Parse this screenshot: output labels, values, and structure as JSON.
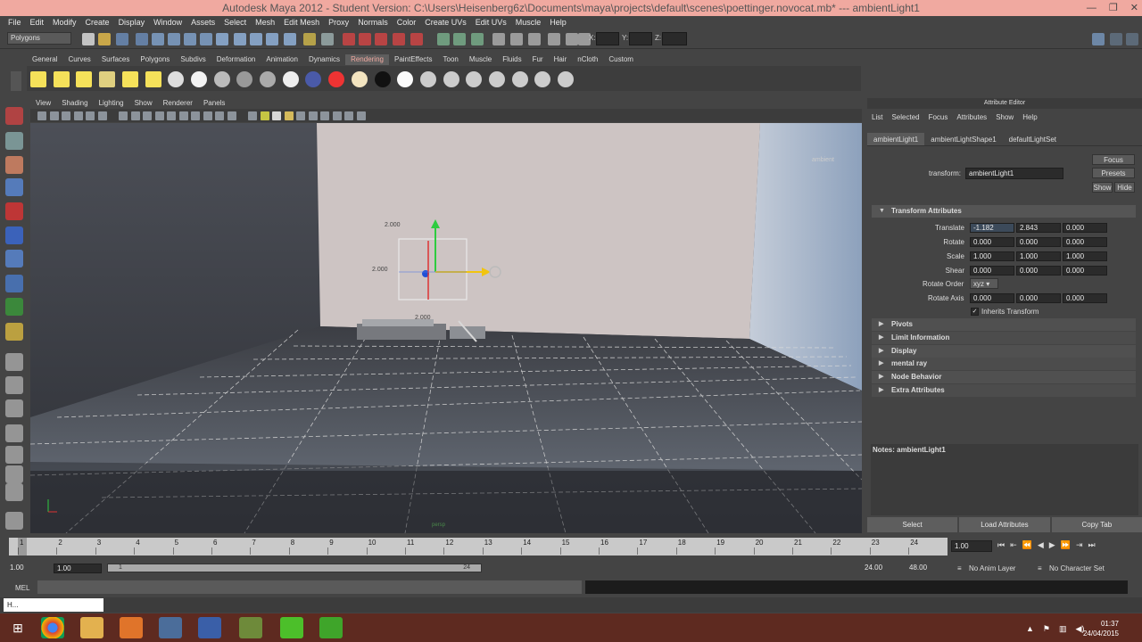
{
  "window": {
    "title": "Autodesk Maya 2012 - Student Version: C:\\Users\\Heisenberg6z\\Documents\\maya\\projects\\default\\scenes\\poettinger.novocat.mb*  ---  ambientLight1"
  },
  "menubar": [
    "File",
    "Edit",
    "Modify",
    "Create",
    "Display",
    "Window",
    "Assets",
    "Select",
    "Mesh",
    "Edit Mesh",
    "Proxy",
    "Normals",
    "Color",
    "Create UVs",
    "Edit UVs",
    "Muscle",
    "Help"
  ],
  "status": {
    "mode": "Polygons",
    "x_label": "X:",
    "y_label": "Y:",
    "z_label": "Z:"
  },
  "shelf_tabs": [
    "General",
    "Curves",
    "Surfaces",
    "Polygons",
    "Subdivs",
    "Deformation",
    "Animation",
    "Dynamics",
    "Rendering",
    "PaintEffects",
    "Toon",
    "Muscle",
    "Fluids",
    "Fur",
    "Hair",
    "nCloth",
    "Custom"
  ],
  "shelf_active": "Rendering",
  "viewport": {
    "menu": [
      "View",
      "Shading",
      "Lighting",
      "Show",
      "Renderer",
      "Panels"
    ],
    "gizmo_labels": [
      "2.000",
      "2.000",
      "2.000"
    ],
    "light_label": "ambient",
    "hud": "persp"
  },
  "attr_editor": {
    "title": "Attribute Editor",
    "menu": [
      "List",
      "Selected",
      "Focus",
      "Attributes",
      "Show",
      "Help"
    ],
    "tabs": [
      "ambientLight1",
      "ambientLightShape1",
      "defaultLightSet"
    ],
    "transform_label": "transform:",
    "transform_name": "ambientLight1",
    "focus": "Focus",
    "presets": "Presets",
    "show": "Show",
    "hide": "Hide",
    "section_title": "Transform Attributes",
    "rows": [
      {
        "label": "Translate",
        "v": [
          "-1.182",
          "2.843",
          "0.000"
        ]
      },
      {
        "label": "Rotate",
        "v": [
          "0.000",
          "0.000",
          "0.000"
        ]
      },
      {
        "label": "Scale",
        "v": [
          "1.000",
          "1.000",
          "1.000"
        ]
      },
      {
        "label": "Shear",
        "v": [
          "0.000",
          "0.000",
          "0.000"
        ]
      }
    ],
    "rotate_order_label": "Rotate Order",
    "rotate_order": "xyz",
    "rotate_axis_label": "Rotate Axis",
    "rotate_axis": [
      "0.000",
      "0.000",
      "0.000"
    ],
    "inherits": "Inherits Transform",
    "sections": [
      "Pivots",
      "Limit Information",
      "Display",
      "mental ray",
      "Node Behavior",
      "Extra Attributes"
    ],
    "notes": "Notes: ambientLight1",
    "buttons": [
      "Select",
      "Load Attributes",
      "Copy Tab"
    ]
  },
  "timeline": {
    "ticks": [
      "1",
      "2",
      "3",
      "4",
      "5",
      "6",
      "7",
      "8",
      "9",
      "10",
      "11",
      "12",
      "13",
      "14",
      "15",
      "16",
      "17",
      "18",
      "19",
      "20",
      "21",
      "22",
      "23",
      "24"
    ],
    "current": "1.00",
    "start": "1.00",
    "start2": "1.00",
    "range_start_mark": "1",
    "range_end_mark": "24",
    "end": "24.00",
    "end2": "48.00",
    "anim_layer": "No Anim Layer",
    "char_set": "No Character Set"
  },
  "cmd": {
    "label": "MEL"
  },
  "help": {
    "text": "H..."
  },
  "clock": {
    "time": "01:37",
    "date": "24/04/2015"
  }
}
